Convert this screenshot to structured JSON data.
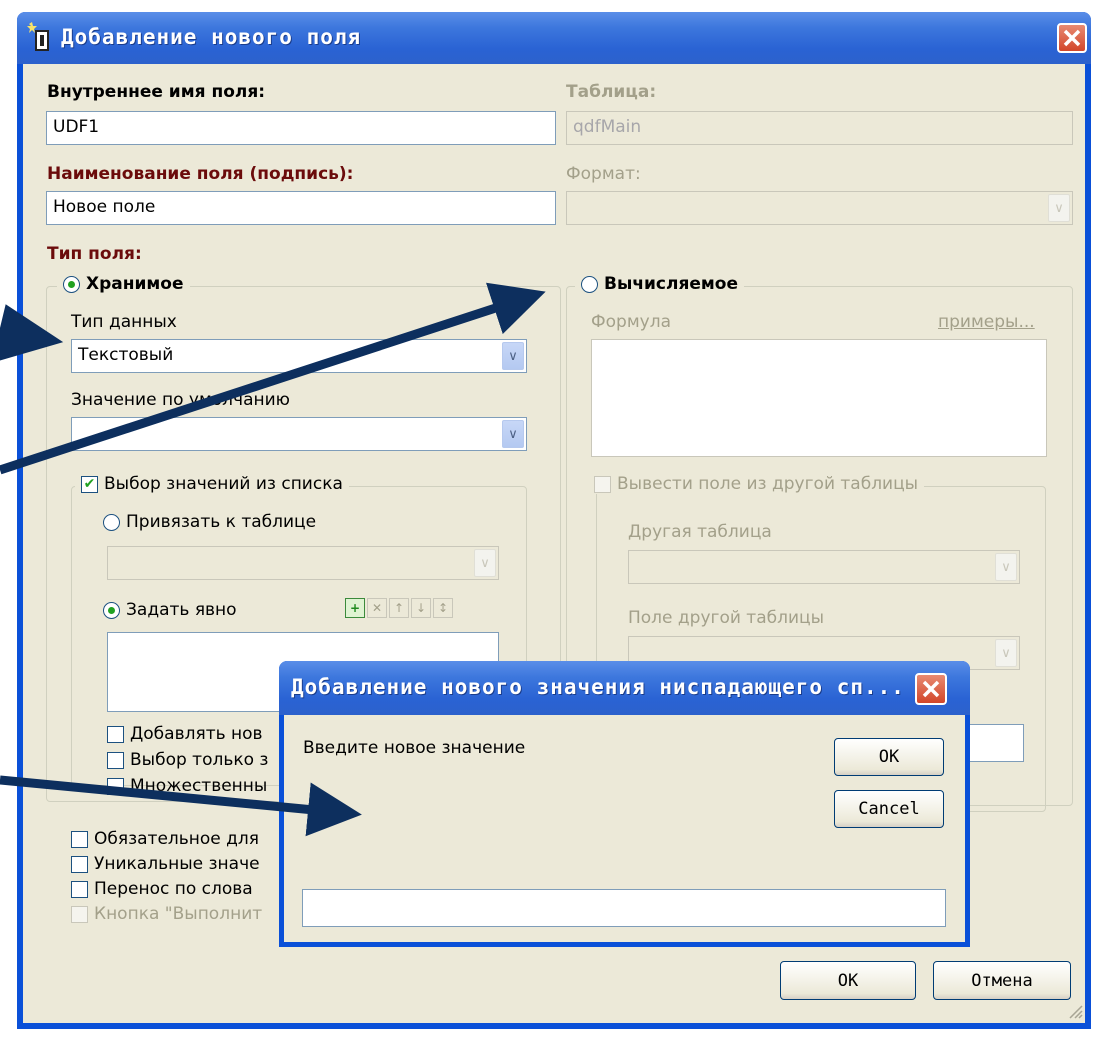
{
  "main_window": {
    "title": "Добавление нового поля",
    "internal_name_label": "Внутреннее имя поля:",
    "internal_name_value": "UDF1",
    "table_label": "Таблица:",
    "table_value": "qdfMain",
    "caption_label": "Наименование поля (подпись):",
    "caption_value": "Новое поле",
    "format_label": "Формат:",
    "format_value": "",
    "field_type_label": "Тип поля:",
    "stored": {
      "label": "Хранимое",
      "selected": true,
      "data_type_label": "Тип данных",
      "data_type_value": "Текстовый",
      "default_label": "Значение по умолчанию",
      "default_value": "",
      "list_choice_label": "Выбор значений из списка",
      "list_choice_checked": true,
      "bind_table_label": "Привязать к таблице",
      "explicit_label": "Задать явно",
      "options": [
        {
          "label": "Добавлять нов",
          "checked": false
        },
        {
          "label": "Выбор только з",
          "checked": false
        },
        {
          "label": "Множественны",
          "checked": false
        }
      ],
      "required_label": "Обязательное для",
      "unique_label": "Уникальные значе",
      "wrap_label": "Перенос по слова",
      "run_button_label": "Кнопка \"Выполнит"
    },
    "computed": {
      "label": "Вычисляемое",
      "selected": false,
      "formula_label": "Формула",
      "examples_link": "примеры...",
      "other_table_field_label": "Вывести поле из другой таблицы",
      "other_table_label": "Другая таблица",
      "other_field_label": "Поле другой таблицы"
    },
    "ok_label": "OK",
    "cancel_label": "Отмена"
  },
  "popup": {
    "title": "Добавление нового значения ниспадающего сп...",
    "prompt": "Введите новое значение",
    "ok_label": "OK",
    "cancel_label": "Cancel",
    "input_value": ""
  },
  "colors": {
    "titlebar": "#2a63d4",
    "dialog_bg": "#ece9d8",
    "label_red": "#6b0b0b",
    "arrow": "#0d2f5e"
  }
}
